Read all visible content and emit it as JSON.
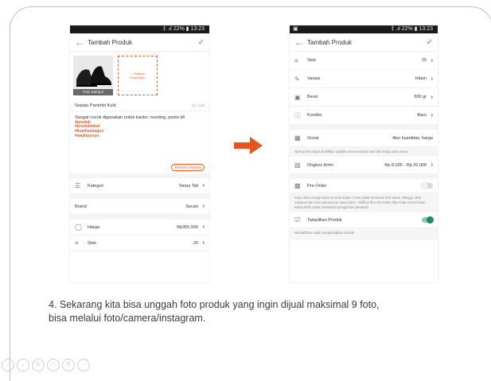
{
  "left": {
    "status": "‡ .ıl 22% ▮ 13:23",
    "title": "Tambah Produk",
    "cover_label": "Foto Sampul",
    "add_photo_label": "+ Tambah Foto/Video",
    "product_name": "Sepatu Pantofel Kulit",
    "name_count": "21 / 100",
    "description": "Sangat cocok digunakan untuk kantor, meeting, pesta dll",
    "hashtags": [
      "#produk",
      "#produklokal",
      "#kualitasbagus",
      "#wajibpunya"
    ],
    "add_hashtag": "Tambah Hashtag",
    "rows": [
      {
        "label": "Kategori",
        "value": "Tanpa Tali"
      },
      {
        "label": "Brand",
        "value": "Serasi"
      },
      {
        "label": "Harga",
        "value": "Rp355.000"
      },
      {
        "label": "Stok",
        "value": "20"
      }
    ]
  },
  "right": {
    "status_left": "▣",
    "status": "‡ .ıl 22% ▮ 13:23",
    "title": "Tambah Produk",
    "rows": [
      {
        "label": "Stok",
        "value": "20"
      },
      {
        "label": "Variasi",
        "value": "Hitam"
      },
      {
        "label": "Berat",
        "value": "500 gr"
      },
      {
        "label": "Kondisi",
        "value": "Baru"
      }
    ],
    "grosir_label": "Grosir",
    "grosir_value": "Atur kuantitas, harga",
    "grosir_note": "Opsi grosir dapat diaktifkan apabila semua variasi memiliki harga yang sama.",
    "ongkos_label": "Ongkos Kirim",
    "ongkos_value": "Rp 8.000 - Rp 26.000",
    "preorder_label": "Pre-Order",
    "preorder_on": false,
    "preorder_note": "Saya akan mengirimkan produk dalam 2 hari (tidak termasuk hari Sabtu, Minggu, libur nasional dan non-operasional Jasa Kirim). Aktifkan fitur Pre-Order bila Anda memerlukan waktu lebih untuk melakukan pengiriman pesanan.",
    "tampilkan_label": "Tampilkan Produk",
    "tampilkan_on": true,
    "tampilkan_note": "Nonaktifkan untuk mengarsipkan produk"
  },
  "caption_line1": "4. Sekarang kita bisa unggah foto produk yang ingin dijual maksimal 9 foto,",
  "caption_line2": "bisa melalui foto/camera/instagram.",
  "colors": {
    "accent": "#f25a1d",
    "toggle_on": "#1a8a6e",
    "arrow": "#e8541e"
  },
  "toolbar_icons": [
    "prev-icon",
    "next-icon",
    "pen-icon",
    "copy-icon",
    "zoom-icon",
    "more-icon"
  ]
}
